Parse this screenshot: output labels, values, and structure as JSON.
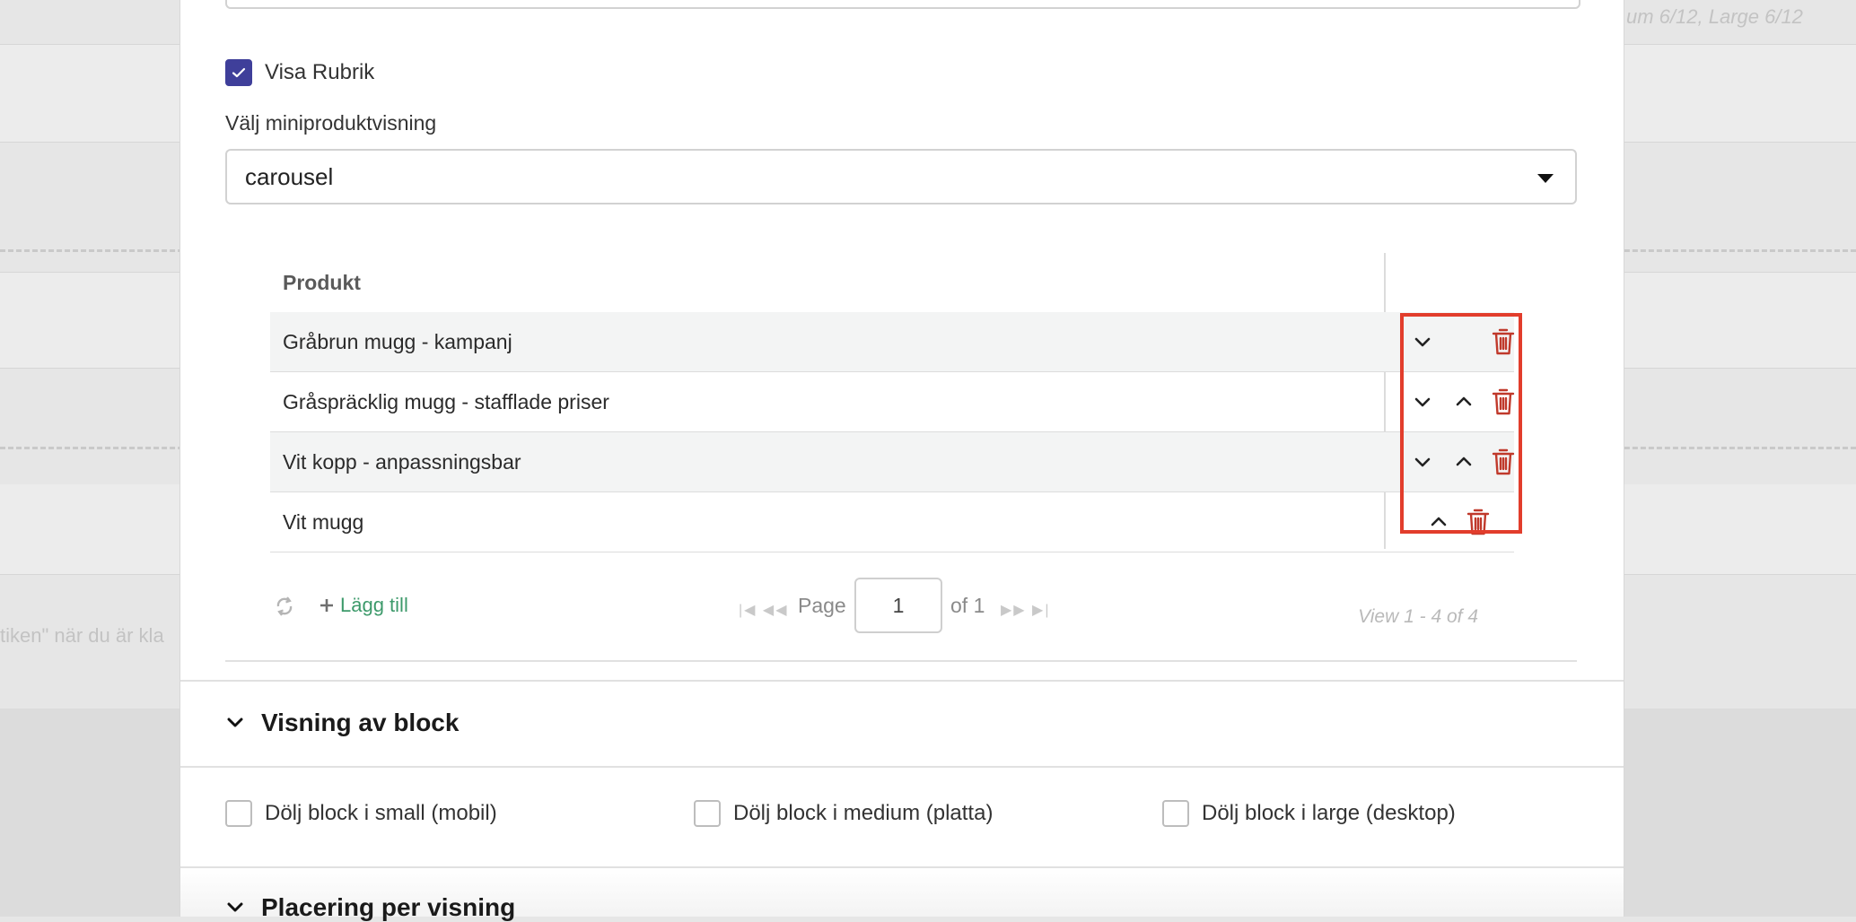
{
  "background": {
    "top_right_text": "um 6/12, Large 6/12",
    "left_text": "tiken\" när du är kla"
  },
  "form": {
    "show_heading_label": "Visa Rubrik",
    "show_heading_checked": true,
    "mini_view_label": "Välj miniproduktvisning",
    "mini_view_value": "carousel"
  },
  "grid": {
    "column_header": "Produkt",
    "rows": [
      {
        "name": "Gråbrun mugg - kampanj",
        "can_move_down": true,
        "can_move_up": false
      },
      {
        "name": "Gråspräcklig mugg - stafflade priser",
        "can_move_down": true,
        "can_move_up": true
      },
      {
        "name": "Vit kopp - anpassningsbar",
        "can_move_down": true,
        "can_move_up": true
      },
      {
        "name": "Vit mugg",
        "can_move_down": false,
        "can_move_up": true
      }
    ],
    "icons": {
      "down": "chevron-down-icon",
      "up": "chevron-up-icon",
      "delete": "trash-icon"
    },
    "delete_color": "#c0392b",
    "highlight_color": "#e23d2c"
  },
  "pager": {
    "add_label": "Lägg till",
    "page_label": "Page",
    "page_value": "1",
    "of_label": "of 1",
    "view_label": "View 1 - 4 of 4",
    "add_color": "#3d9a6b"
  },
  "sections": {
    "visning_title": "Visning av block",
    "hide_small": "Dölj block i small (mobil)",
    "hide_medium": "Dölj block i medium (platta)",
    "hide_large": "Dölj block i large (desktop)",
    "placering_title": "Placering per visning"
  }
}
